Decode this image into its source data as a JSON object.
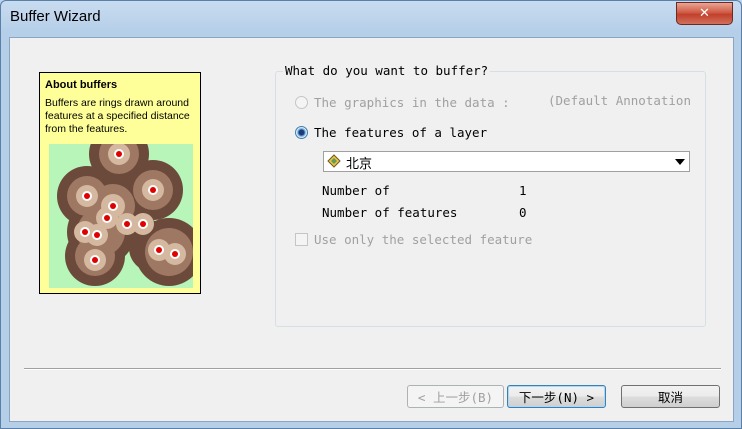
{
  "window": {
    "title": "Buffer Wizard",
    "close_glyph": "✕"
  },
  "illustration": {
    "title": "About buffers",
    "description": "Buffers are rings drawn around features at a specified distance from the features."
  },
  "form": {
    "group_label": "What do you want to buffer?",
    "option_graphics": {
      "label": "The graphics in the data :",
      "extra": "(Default Annotation",
      "enabled": false,
      "checked": false
    },
    "option_layer": {
      "label": "The features of a layer",
      "enabled": true,
      "checked": true
    },
    "layer_select": {
      "value": "北京",
      "icon": "polygon-layer-icon"
    },
    "stats": [
      {
        "label": "Number of",
        "value": "1"
      },
      {
        "label": "Number of features",
        "value": "0"
      }
    ],
    "selected_only": {
      "label": "Use only the selected feature",
      "enabled": false,
      "checked": false
    }
  },
  "buttons": {
    "back": "< 上一步(B)",
    "next": "下一步(N) >",
    "cancel": "取消"
  },
  "colors": {
    "illustration_bg": "#ffff99",
    "ring_dark": "#6b4a3c",
    "ring_mid": "#9e7862",
    "ring_light": "#d5b8a0",
    "point": "#e00000",
    "map_bg": "#b8f5b8"
  }
}
